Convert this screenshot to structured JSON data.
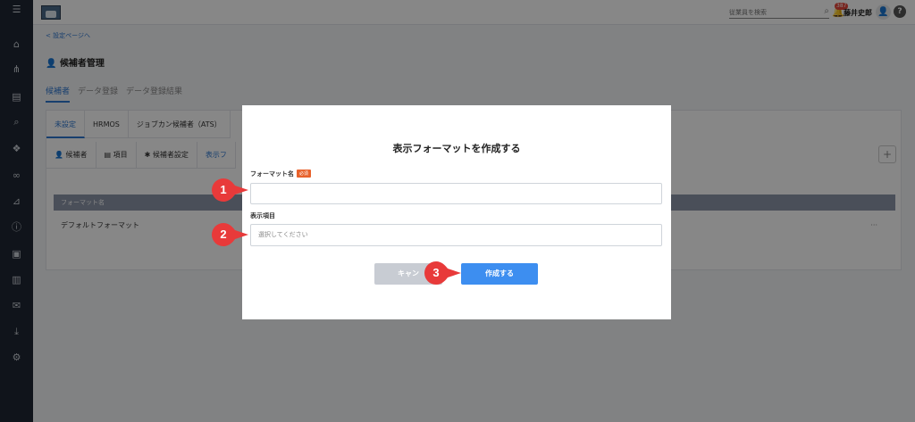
{
  "sidebar": {
    "menu_icon": "☰",
    "items": [
      {
        "name": "home-icon",
        "glyph": "⌂"
      },
      {
        "name": "org-chart-icon",
        "glyph": "⋔"
      },
      {
        "name": "document-icon",
        "glyph": "▤"
      },
      {
        "name": "search-icon",
        "glyph": "⌕"
      },
      {
        "name": "chat-icon",
        "glyph": "❖"
      },
      {
        "name": "link-icon",
        "glyph": "∞"
      },
      {
        "name": "analytics-icon",
        "glyph": "⊿"
      },
      {
        "name": "info-icon",
        "glyph": "ⓘ"
      },
      {
        "name": "contact-card-icon",
        "glyph": "▣"
      },
      {
        "name": "book-icon",
        "glyph": "▥"
      },
      {
        "name": "mail-icon",
        "glyph": "✉"
      },
      {
        "name": "download-icon",
        "glyph": "⤓"
      },
      {
        "name": "user-settings-icon",
        "glyph": "⚙"
      }
    ]
  },
  "topbar": {
    "search_placeholder": "従業員を検索",
    "search_icon": "⌕",
    "bell_icon": "🔔",
    "notification_badge": "387",
    "user_name": "藤井史郎",
    "avatar_icon": "👤",
    "help_icon": "?"
  },
  "page": {
    "back_link": "< 設定ページへ",
    "title": "候補者管理",
    "title_icon": "👤",
    "tabs": [
      {
        "label": "候補者",
        "active": true
      },
      {
        "label": "データ登録",
        "active": false
      },
      {
        "label": "データ登録結果",
        "active": false
      }
    ],
    "source_tabs": [
      {
        "label": "未設定",
        "active": true
      },
      {
        "label": "HRMOS",
        "active": false
      },
      {
        "label": "ジョブカン候補者（ATS）",
        "active": false
      }
    ],
    "sub_tabs": [
      {
        "label": "候補者",
        "icon": "👤",
        "active": false
      },
      {
        "label": "項目",
        "icon": "▤",
        "active": false
      },
      {
        "label": "候補者設定",
        "icon": "✱",
        "active": false
      },
      {
        "label": "表示フ",
        "icon": "",
        "active": true
      }
    ],
    "add_button": "+",
    "table_header": "フォーマット名",
    "table_rows": [
      {
        "name": "デフォルトフォーマット",
        "menu": "···"
      }
    ]
  },
  "modal": {
    "title": "表示フォーマットを作成する",
    "format_name_label": "フォーマット名",
    "required_badge": "必須",
    "format_name_value": "",
    "display_items_label": "表示項目",
    "display_items_placeholder": "選択してください",
    "cancel_button": "キャン",
    "create_button": "作成する"
  },
  "annotations": [
    {
      "label": "1"
    },
    {
      "label": "2"
    },
    {
      "label": "3"
    }
  ],
  "colors": {
    "accent": "#2f77d0",
    "primary_button": "#3d8ef0",
    "marker": "#e83a3a",
    "required": "#e8622c",
    "sidebar": "#1f2733"
  }
}
